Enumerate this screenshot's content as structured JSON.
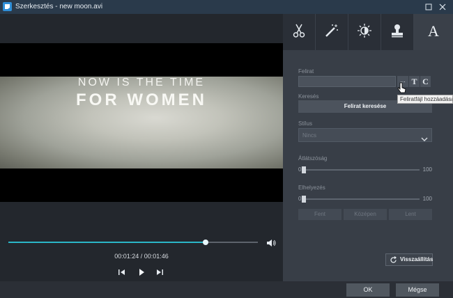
{
  "window": {
    "title": "Szerkesztés - new moon.avi",
    "controls": [
      "maximize-icon",
      "close-icon"
    ]
  },
  "video": {
    "overlay_line1": "NOW IS THE TIME",
    "overlay_line2": "FOR WOMEN",
    "time": "00:01:24 / 00:01:46",
    "progress": 0.79,
    "controls": [
      "previous-frame-icon",
      "play-icon",
      "next-frame-icon",
      "volume-icon"
    ]
  },
  "tabs": [
    "cut-icon",
    "magic-wand-icon",
    "brightness-icon",
    "stamp-icon",
    "text-icon"
  ],
  "subtitle_panel": {
    "subtitle_label": "Felirat",
    "subtitle_value": "",
    "dots_label": "...",
    "t_label": "T",
    "c_label": "C",
    "tooltip": "Feliratfájl hozzáadása",
    "search_label": "Keresés",
    "search_button": "Felirat keresése",
    "style_label": "Stílus",
    "style_value": "Nincs",
    "transparency_label": "Átlátszóság",
    "transparency_min": "0",
    "transparency_max": "100",
    "transparency_value": 0,
    "position_label": "Elhelyezés",
    "position_min": "0",
    "position_max": "100",
    "position_value": 0,
    "position_buttons": [
      "Fent",
      "Középen",
      "Lent"
    ],
    "reset_button": "Visszaállítás"
  },
  "footer": {
    "ok": "OK",
    "cancel": "Mégse"
  },
  "colors": {
    "accent": "#2bb6c7",
    "panel": "#383e47",
    "titlebar": "#2a3a4b"
  }
}
